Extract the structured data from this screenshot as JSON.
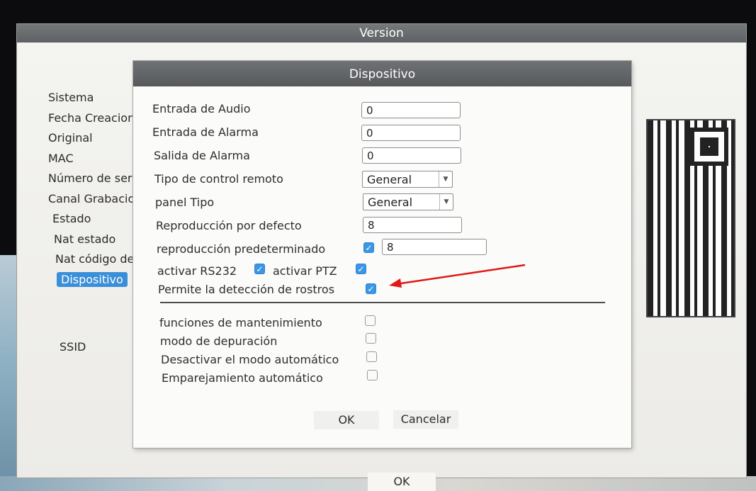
{
  "outer": {
    "title": "Version",
    "left_items": [
      "Sistema",
      "Fecha Creacion",
      "Original",
      "MAC",
      "Número de seri",
      "Canal Grabacio",
      "Estado",
      "Nat estado",
      "Nat código de e",
      "Dispositivo"
    ],
    "ssid_label": "SSID",
    "ok_label": "OK"
  },
  "dialog": {
    "title": "Dispositivo",
    "audio_input": {
      "label": "Entrada de Audio",
      "value": "0"
    },
    "alarm_input": {
      "label": "Entrada de Alarma",
      "value": "0"
    },
    "alarm_output": {
      "label": "Salida de Alarma",
      "value": "0"
    },
    "remote_type": {
      "label": "Tipo de control remoto",
      "value": "General"
    },
    "panel_type": {
      "label": "panel Tipo",
      "value": "General"
    },
    "default_playback": {
      "label": "Reproducción por defecto",
      "value": "8"
    },
    "predetermined_playback": {
      "label": "reproducción predeterminado",
      "checked": true,
      "value": "8"
    },
    "rs232": {
      "label": "activar RS232",
      "checked": true
    },
    "ptz": {
      "label": "activar PTZ",
      "checked": true
    },
    "face_detection": {
      "label": "Permite la detección de rostros",
      "checked": true
    },
    "maintenance": {
      "label": "funciones de mantenimiento",
      "checked": false
    },
    "debug_mode": {
      "label": "modo de depuración",
      "checked": false
    },
    "disable_auto": {
      "label": "Desactivar el modo automático",
      "checked": false
    },
    "auto_pairing": {
      "label": "Emparejamiento automático",
      "checked": false
    },
    "ok_label": "OK",
    "cancel_label": "Cancelar"
  },
  "colors": {
    "accent": "#3d96e4",
    "titlebar": "#5f6265",
    "annotation_arrow": "#e01818"
  },
  "icons": {
    "check": "✓",
    "dropdown": "▼"
  }
}
